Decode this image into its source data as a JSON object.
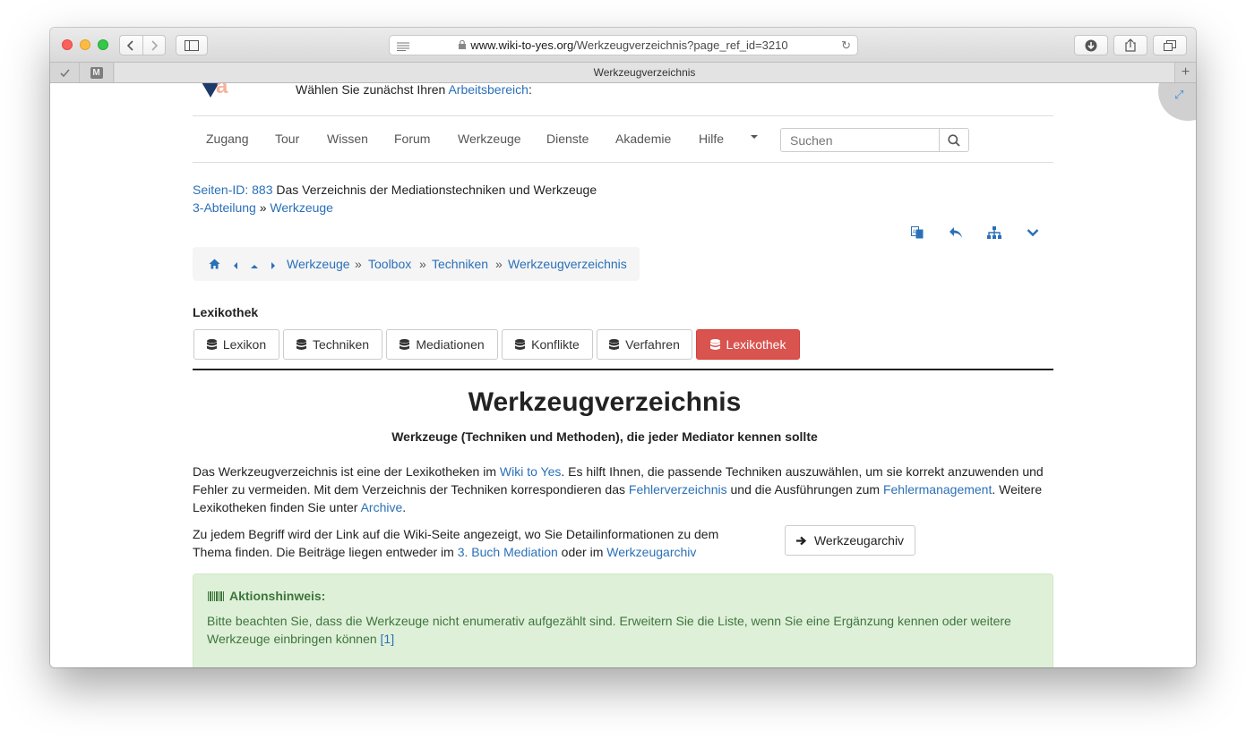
{
  "browser": {
    "url_host": "www.wiki-to-yes.org",
    "url_path": "/Werkzeugverzeichnis?page_ref_id=3210",
    "tab_title": "Werkzeugverzeichnis",
    "favorite_m": "M"
  },
  "header": {
    "choose_text": "Wählen Sie zunächst Ihren ",
    "choose_link": "Arbeitsbereich",
    "choose_suffix": ":"
  },
  "nav": {
    "items": [
      "Zugang",
      "Tour",
      "Wissen",
      "Forum",
      "Werkzeuge",
      "Dienste",
      "Akademie",
      "Hilfe"
    ],
    "search_placeholder": "Suchen"
  },
  "meta": {
    "page_id_link": "Seiten-ID: 883",
    "page_id_text": " Das Verzeichnis der Mediationstechniken und Werkzeuge",
    "section_link": "3-Abteilung",
    "section_sep": " » ",
    "section_link2": "Werkzeuge"
  },
  "breadcrumb": {
    "items": [
      "Werkzeuge",
      "Toolbox",
      "Techniken",
      "Werkzeugverzeichnis"
    ],
    "separator": "»"
  },
  "lexikothek": {
    "heading": "Lexikothek",
    "tabs": [
      "Lexikon",
      "Techniken",
      "Mediationen",
      "Konflikte",
      "Verfahren",
      "Lexikothek"
    ],
    "active_index": 5
  },
  "content": {
    "title": "Werkzeugverzeichnis",
    "subtitle": "Werkzeuge (Techniken und Methoden), die jeder Mediator kennen sollte",
    "p1": {
      "t1": "Das Werkzeugverzeichnis ist eine der Lexikotheken im ",
      "l1": "Wiki to Yes",
      "t2": ". Es hilft Ihnen, die passende Techniken auszuwählen, um sie korrekt anzuwenden und Fehler zu vermeiden. Mit dem Verzeichnis der Techniken korrespondieren das ",
      "l2": "Fehlerverzeichnis",
      "t3": " und die Ausführungen zum ",
      "l3": "Fehlermanagement",
      "t4": ". Weitere Lexikotheken finden Sie unter ",
      "l4": "Archive",
      "t5": "."
    },
    "p2": {
      "t1": "Zu jedem Begriff wird der Link auf die Wiki-Seite angezeigt, wo Sie Detailinformationen zu dem Thema finden. Die Beiträge liegen entweder im ",
      "l1": "3. Buch Mediation",
      "t2": " oder im ",
      "l2": "Werkzeugarchiv"
    },
    "archive_button": "Werkzeugarchiv"
  },
  "alert": {
    "heading": "Aktionshinweis:",
    "body": "Bitte beachten Sie, dass die Werkzeuge nicht enumerativ aufgezählt sind. Erweitern Sie die Liste, wenn Sie eine Ergänzung kennen oder weitere Werkzeuge einbringen können ",
    "ref": "[1]"
  },
  "colors": {
    "link": "#2a70b8",
    "active_tab": "#d9534f",
    "alert_bg": "#dff0d8",
    "alert_text": "#3c763d"
  }
}
